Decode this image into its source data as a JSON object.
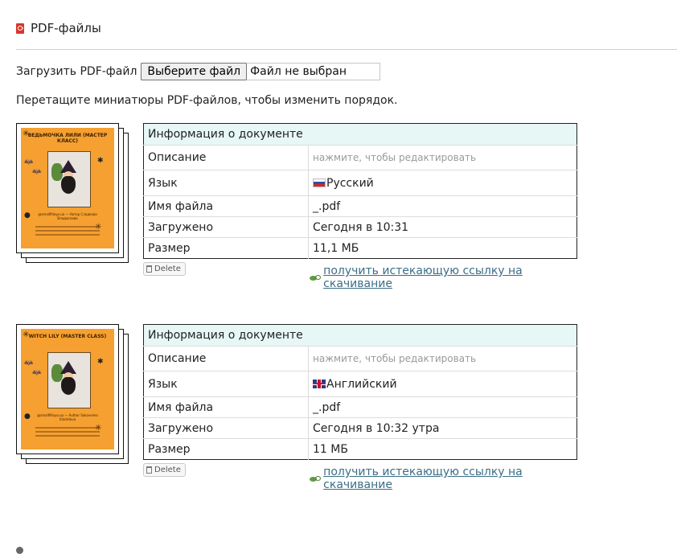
{
  "section": {
    "title": "PDF-файлы",
    "icon": "pdf-file-icon"
  },
  "upload": {
    "label": "Загрузить PDF-файл",
    "button_label": "Выберите файл",
    "status": "Файл не выбран"
  },
  "hint": "Перетащите миниатюры PDF-файлов, чтобы изменить порядок.",
  "documents": [
    {
      "thumbnail": {
        "cover_title": "ВЕДЬМОЧКА ЛИЛИ (МАСТЕР КЛАСС)",
        "cover_caption": "@smallfilloyo.ua — Автор Сладкова Владислава"
      },
      "table_header": "Информация о документе",
      "rows": {
        "description_key": "Описание",
        "description_value": "нажмите, чтобы редактировать",
        "language_key": "Язык",
        "language_value": "Русский",
        "filename_key": "Имя файла",
        "filename_value": "_.pdf",
        "uploaded_key": "Загружено",
        "uploaded_value": "Сегодня в 10:31",
        "size_key": "Размер",
        "size_value": "11,1 МБ"
      },
      "delete_label": "Delete",
      "link_label": "получить истекающую ссылку на скачивание"
    },
    {
      "thumbnail": {
        "cover_title": "WITCH LILY (MASTER CLASS)",
        "cover_caption": "@smallfilloyo.ua — Author Sokovenko Vladislava"
      },
      "table_header": "Информация о документе",
      "rows": {
        "description_key": "Описание",
        "description_value": "нажмите, чтобы редактировать",
        "language_key": "Язык",
        "language_value": "Английский",
        "filename_key": "Имя файла",
        "filename_value": "_.pdf",
        "uploaded_key": "Загружено",
        "uploaded_value": "Сегодня в 10:32 утра",
        "size_key": "Размер",
        "size_value": "11 МБ"
      },
      "delete_label": "Delete",
      "link_label": "получить истекающую ссылку на скачивание"
    }
  ],
  "colors": {
    "table_header_bg": "#e6f7f6",
    "link": "#3b6e87",
    "pdf_icon": "#d9362c",
    "cover_orange": "#f5a030"
  }
}
